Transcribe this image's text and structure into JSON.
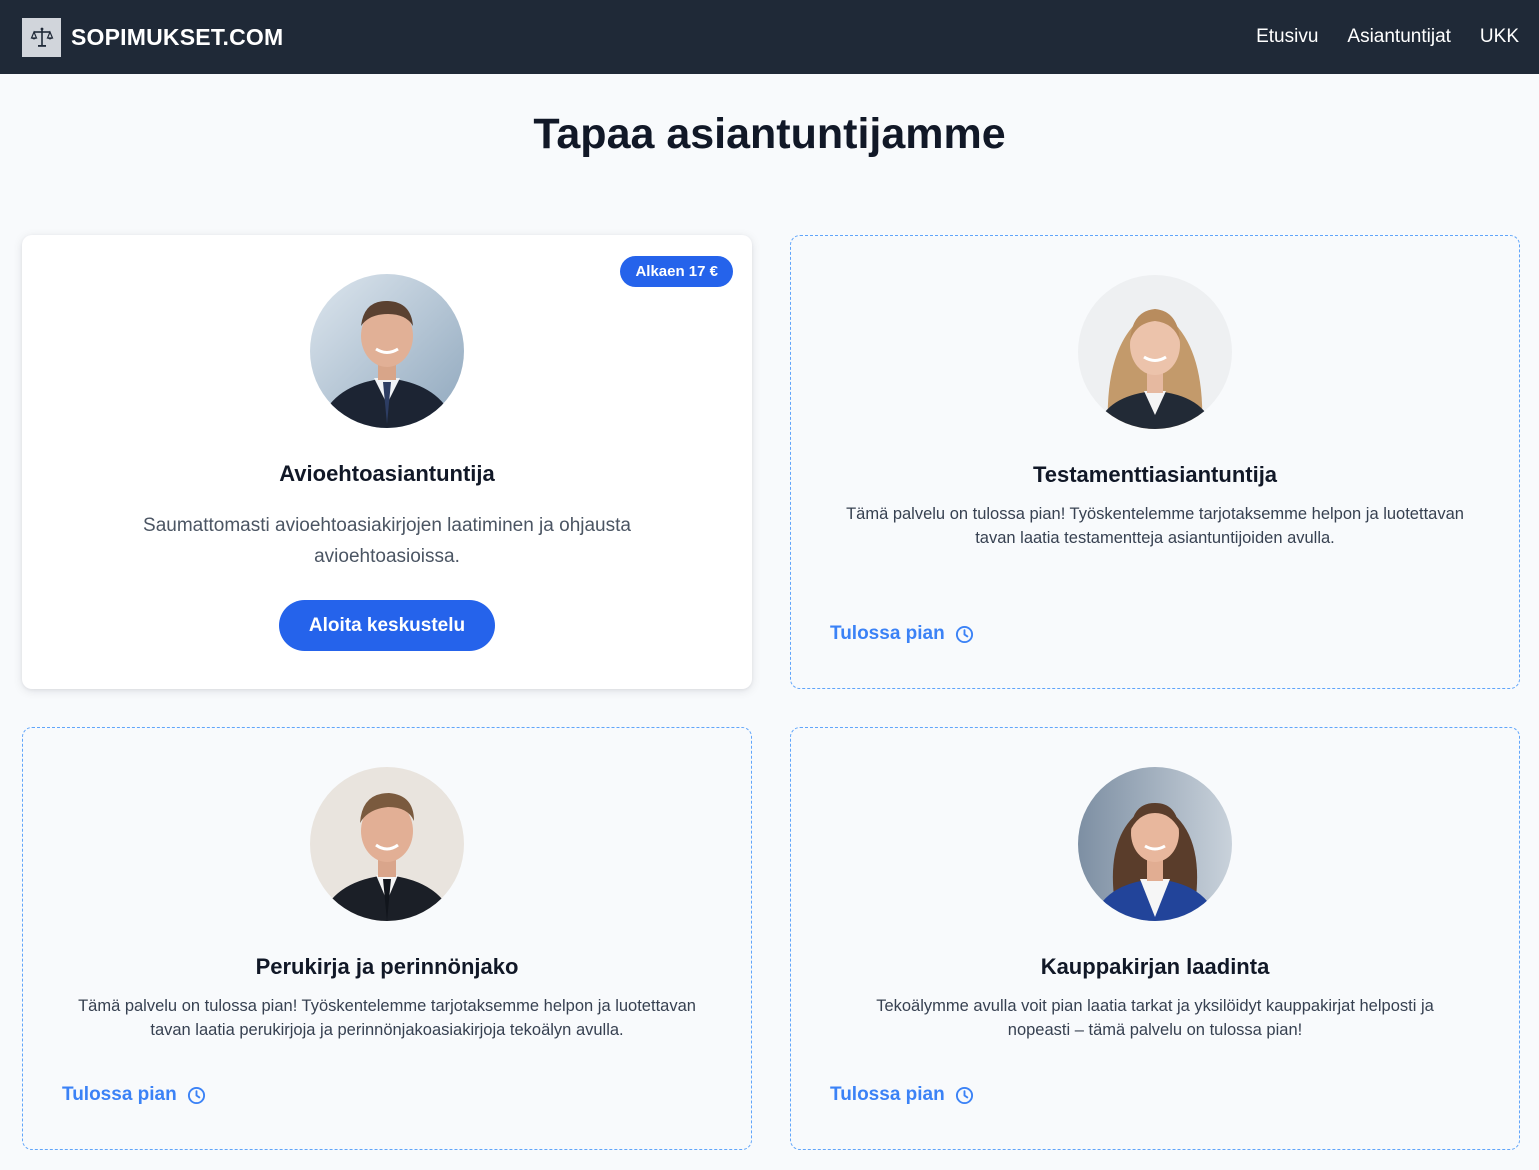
{
  "header": {
    "brand": "SOPIMUKSET.COM",
    "logo_icon": "scales-of-justice-icon",
    "nav": [
      "Etusivu",
      "Asiantuntijat",
      "UKK"
    ]
  },
  "page": {
    "title": "Tapaa asiantuntijamme"
  },
  "cards": [
    {
      "title": "Avioehtoasiantuntija",
      "badge": "Alkaen 17 €",
      "description": "Saumattomasti avioehtoasiakirjojen laatiminen ja ohjausta avioehtoasioissa.",
      "button": "Aloita keskustelu",
      "avatar": "man-in-suit-photo"
    },
    {
      "title": "Testamenttiasiantuntija",
      "description": "Tämä palvelu on tulossa pian! Työskentelemme tarjotaksemme helpon ja luotettavan tavan laatia testamentteja asiantuntijoiden avulla.",
      "status": "Tulossa pian",
      "status_icon": "clock-icon",
      "avatar": "blonde-woman-photo"
    },
    {
      "title": "Perukirja ja perinnönjako",
      "description": "Tämä palvelu on tulossa pian! Työskentelemme tarjotaksemme helpon ja luotettavan tavan laatia perukirjoja ja perinnönjakoasiakirjoja tekoälyn avulla.",
      "status": "Tulossa pian",
      "status_icon": "clock-icon",
      "avatar": "man-with-tie-photo"
    },
    {
      "title": "Kauppakirjan laadinta",
      "description": "Tekoälymme avulla voit pian laatia tarkat ja yksilöidyt kauppakirjat helposti ja nopeasti – tämä palvelu on tulossa pian!",
      "status": "Tulossa pian",
      "status_icon": "clock-icon",
      "avatar": "brunette-woman-blue-blazer-photo"
    }
  ],
  "colors": {
    "header_bg": "#1f2937",
    "accent": "#2563eb",
    "soon_text": "#3b82f6",
    "page_bg": "#f8fafc"
  }
}
